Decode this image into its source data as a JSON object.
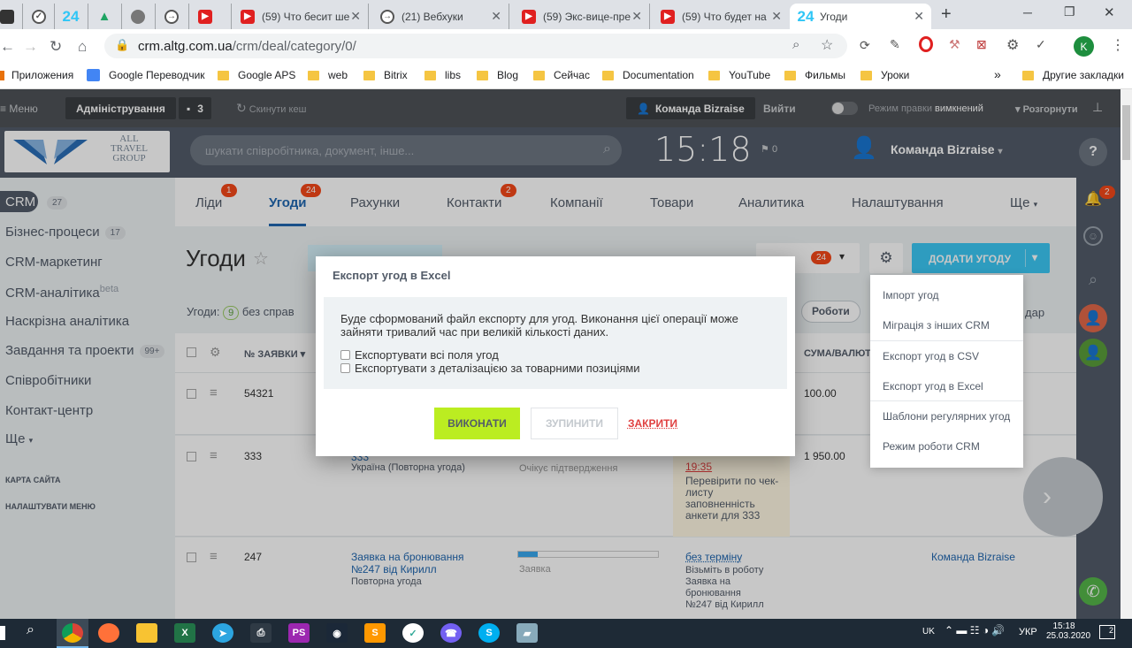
{
  "browser": {
    "tabs": [
      {
        "title": "",
        "fav": "▢"
      },
      {
        "title": "",
        "fav": "✓"
      },
      {
        "title": "",
        "fav": "24"
      },
      {
        "title": "",
        "fav": "▲"
      },
      {
        "title": "",
        "fav": "◍"
      },
      {
        "title": "",
        "fav": "→"
      },
      {
        "title": "",
        "fav": "▶"
      },
      {
        "title": "(59) Что бесит ше",
        "fav": "▶"
      },
      {
        "title": "(21) Вебхуки",
        "fav": "→"
      },
      {
        "title": "(59) Экс-вице-пре",
        "fav": "▶"
      },
      {
        "title": "(59) Что будет на",
        "fav": "▶"
      },
      {
        "title": "Угоди",
        "fav": "24"
      }
    ],
    "url_host": "crm.altg.com.ua",
    "url_path": "/crm/deal/category/0/",
    "profile_initial": "K",
    "bookmarks": [
      "Приложения",
      "Google Переводчик",
      "Google APS",
      "web",
      "Bitrix",
      "libs",
      "Blog",
      "Сейчас",
      "Documentation",
      "YouTube",
      "Фильмы",
      "Уроки"
    ],
    "bookmarks_more": "»",
    "other_bookmarks": "Другие закладки"
  },
  "panel": {
    "menu": "Меню",
    "admin": "Адміністрування",
    "count": "3",
    "reset_cache": "Скинути кеш",
    "team": "Команда Bizraise",
    "logout": "Вийти",
    "edit_mode": "Режим правки",
    "edit_state": "вимкнений",
    "expand": "Розгорнути"
  },
  "header": {
    "logo_line1": "ALL",
    "logo_line2": "TRAVEL",
    "logo_line3": "GROUP",
    "search_placeholder": "шукати співробітника, документ, інше...",
    "clock": "15:18",
    "flag_count": "0",
    "user": "Команда Bizraise"
  },
  "leftmenu": {
    "items": [
      {
        "label": "CRM",
        "count": "27"
      },
      {
        "label": "Бізнес-процеси",
        "count": "17"
      },
      {
        "label": "CRM-маркетинг",
        "count": ""
      },
      {
        "label": "CRM-аналітика",
        "count": "beta"
      },
      {
        "label": "Наскрізна аналітика",
        "count": ""
      },
      {
        "label": "Завдання та проекти",
        "count": "99+"
      },
      {
        "label": "Співробітники",
        "count": ""
      },
      {
        "label": "Контакт-центр",
        "count": ""
      },
      {
        "label": "Ще",
        "count": ""
      }
    ],
    "site_map": "КАРТА САЙТА",
    "menu_settings": "НАЛАШТУВАТИ МЕНЮ"
  },
  "crmnav": {
    "items": [
      {
        "label": "Ліди",
        "badge": "1"
      },
      {
        "label": "Угоди",
        "badge": "24"
      },
      {
        "label": "Рахунки",
        "badge": ""
      },
      {
        "label": "Контакти",
        "badge": "2"
      },
      {
        "label": "Компанії",
        "badge": ""
      },
      {
        "label": "Товари",
        "badge": ""
      },
      {
        "label": "Аналитика",
        "badge": ""
      },
      {
        "label": "Налаштування",
        "badge": ""
      },
      {
        "label": "Ще",
        "badge": ""
      }
    ]
  },
  "page": {
    "title": "Угоди",
    "filter_badge": "24",
    "add_button": "ДОДАТИ УГОДУ",
    "deals_label": "Угоди:",
    "deals_count": "9",
    "no_tasks": "без справ",
    "works_chip": "Роботи",
    "calendar": "дар"
  },
  "table": {
    "col_number": "№ ЗАЯВКИ",
    "col_sum": "СУМА/ВАЛЮТА",
    "rows": [
      {
        "number": "54321",
        "title": "",
        "subtitle": "",
        "stage": "",
        "due": "",
        "task": "",
        "sum": "100.00",
        "owner": ""
      },
      {
        "number": "333",
        "title": "333",
        "subtitle": "Україна (Повторна угода)",
        "stage": "Очікує підтвердження",
        "due": "19:35",
        "task": "Перевірити по чек-листу заповненність анкети для 333",
        "sum": "1 950.00",
        "owner": ""
      },
      {
        "number": "247",
        "title": "Заявка на бронювання №247 від Кирилл",
        "subtitle": "Повторна угода",
        "stage": "Заявка",
        "due": "без терміну",
        "task": "Візьміть в роботу Заявка на бронювання №247 від Кирилл",
        "sum": "",
        "owner": "Команда Bizraise"
      }
    ]
  },
  "dropdown": {
    "items": [
      "Імпорт угод",
      "Міграція з інших CRM",
      "Експорт угод в CSV",
      "Експорт угод в Excel",
      "Шаблони регулярних угод",
      "Режим роботи CRM"
    ]
  },
  "modal": {
    "title": "Експорт угод в Excel",
    "text": "Буде сформований файл експорту для угод. Виконання цієї операції може зайняти тривалий час при великій кількості даних.",
    "opt_all": "Експортувати всі поля угод",
    "opt_detail": "Експортувати з деталізацією за товарними позиціями",
    "run": "ВИКОНАТИ",
    "stop": "ЗУПИНИТИ",
    "close": "ЗАКРИТИ"
  },
  "taskbar": {
    "lang_short": "UK",
    "lang": "УКР",
    "time": "15:18",
    "date": "25.03.2020",
    "notif": "2"
  },
  "colors": {
    "accent_green": "#bbed21",
    "accent_blue": "#3bc8f5",
    "header": "#535c69",
    "badge_red": "#f54819"
  }
}
